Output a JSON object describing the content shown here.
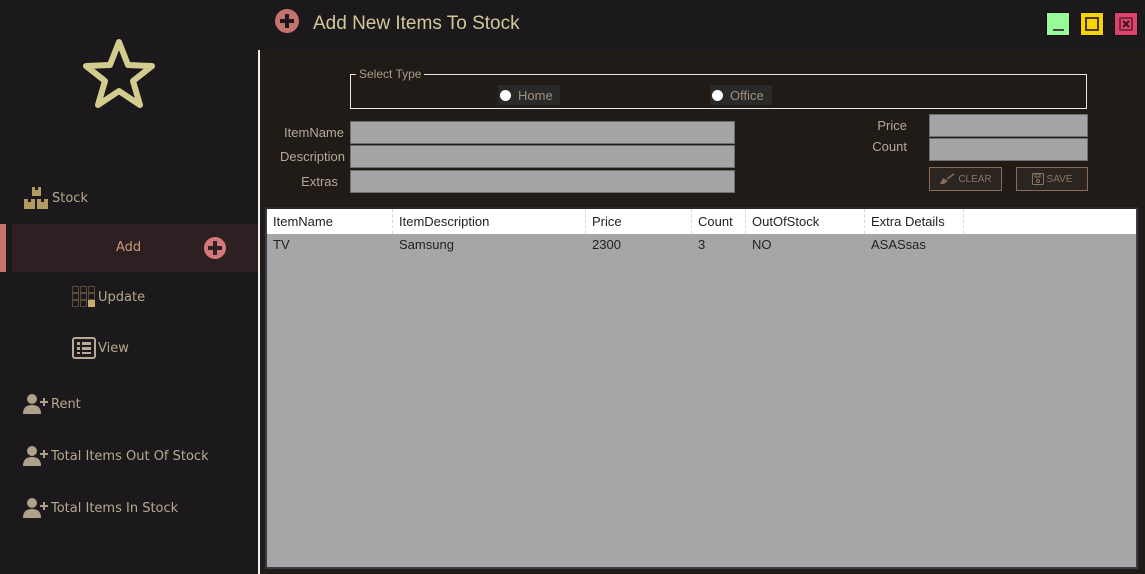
{
  "window": {
    "title": "Add New Items To Stock",
    "title_icon": "plus-circle-icon",
    "controls": [
      {
        "name": "minimize",
        "icon": "minimize-icon",
        "color": "#98fb98"
      },
      {
        "name": "maximize",
        "icon": "maximize-icon",
        "color": "#f5d400"
      },
      {
        "name": "close",
        "icon": "close-icon",
        "color": "#e0436a"
      }
    ]
  },
  "sidebar": {
    "logo_icon": "star-icon",
    "items": [
      {
        "label": "Stock",
        "icon": "boxes-icon"
      },
      {
        "label": "Add",
        "icon": "plus-circle-icon",
        "active": true
      },
      {
        "label": "Update",
        "icon": "grid-icon"
      },
      {
        "label": "View",
        "icon": "list-icon"
      },
      {
        "label": "Rent",
        "icon": "add-user-icon"
      },
      {
        "label": "Total Items Out Of Stock",
        "icon": "add-user-icon"
      },
      {
        "label": "Total Items In Stock",
        "icon": "add-user-icon"
      }
    ]
  },
  "form": {
    "type_group_label": "Select Type",
    "type_options": [
      {
        "label": "Home",
        "selected": false
      },
      {
        "label": "Office",
        "selected": false
      }
    ],
    "fields": {
      "item_name": {
        "label": "ItemName",
        "value": ""
      },
      "description": {
        "label": "Description",
        "value": ""
      },
      "extras": {
        "label": "Extras",
        "value": ""
      },
      "price": {
        "label": "Price",
        "value": ""
      },
      "count": {
        "label": "Count",
        "value": ""
      }
    },
    "clear_label": "CLEAR",
    "save_label": "SAVE"
  },
  "table": {
    "columns": [
      "ItemName",
      "ItemDescription",
      "Price",
      "Count",
      "OutOfStock",
      "Extra Details"
    ],
    "rows": [
      [
        "TV",
        "Samsung",
        "2300",
        "3",
        "NO",
        "ASASsas"
      ]
    ]
  }
}
